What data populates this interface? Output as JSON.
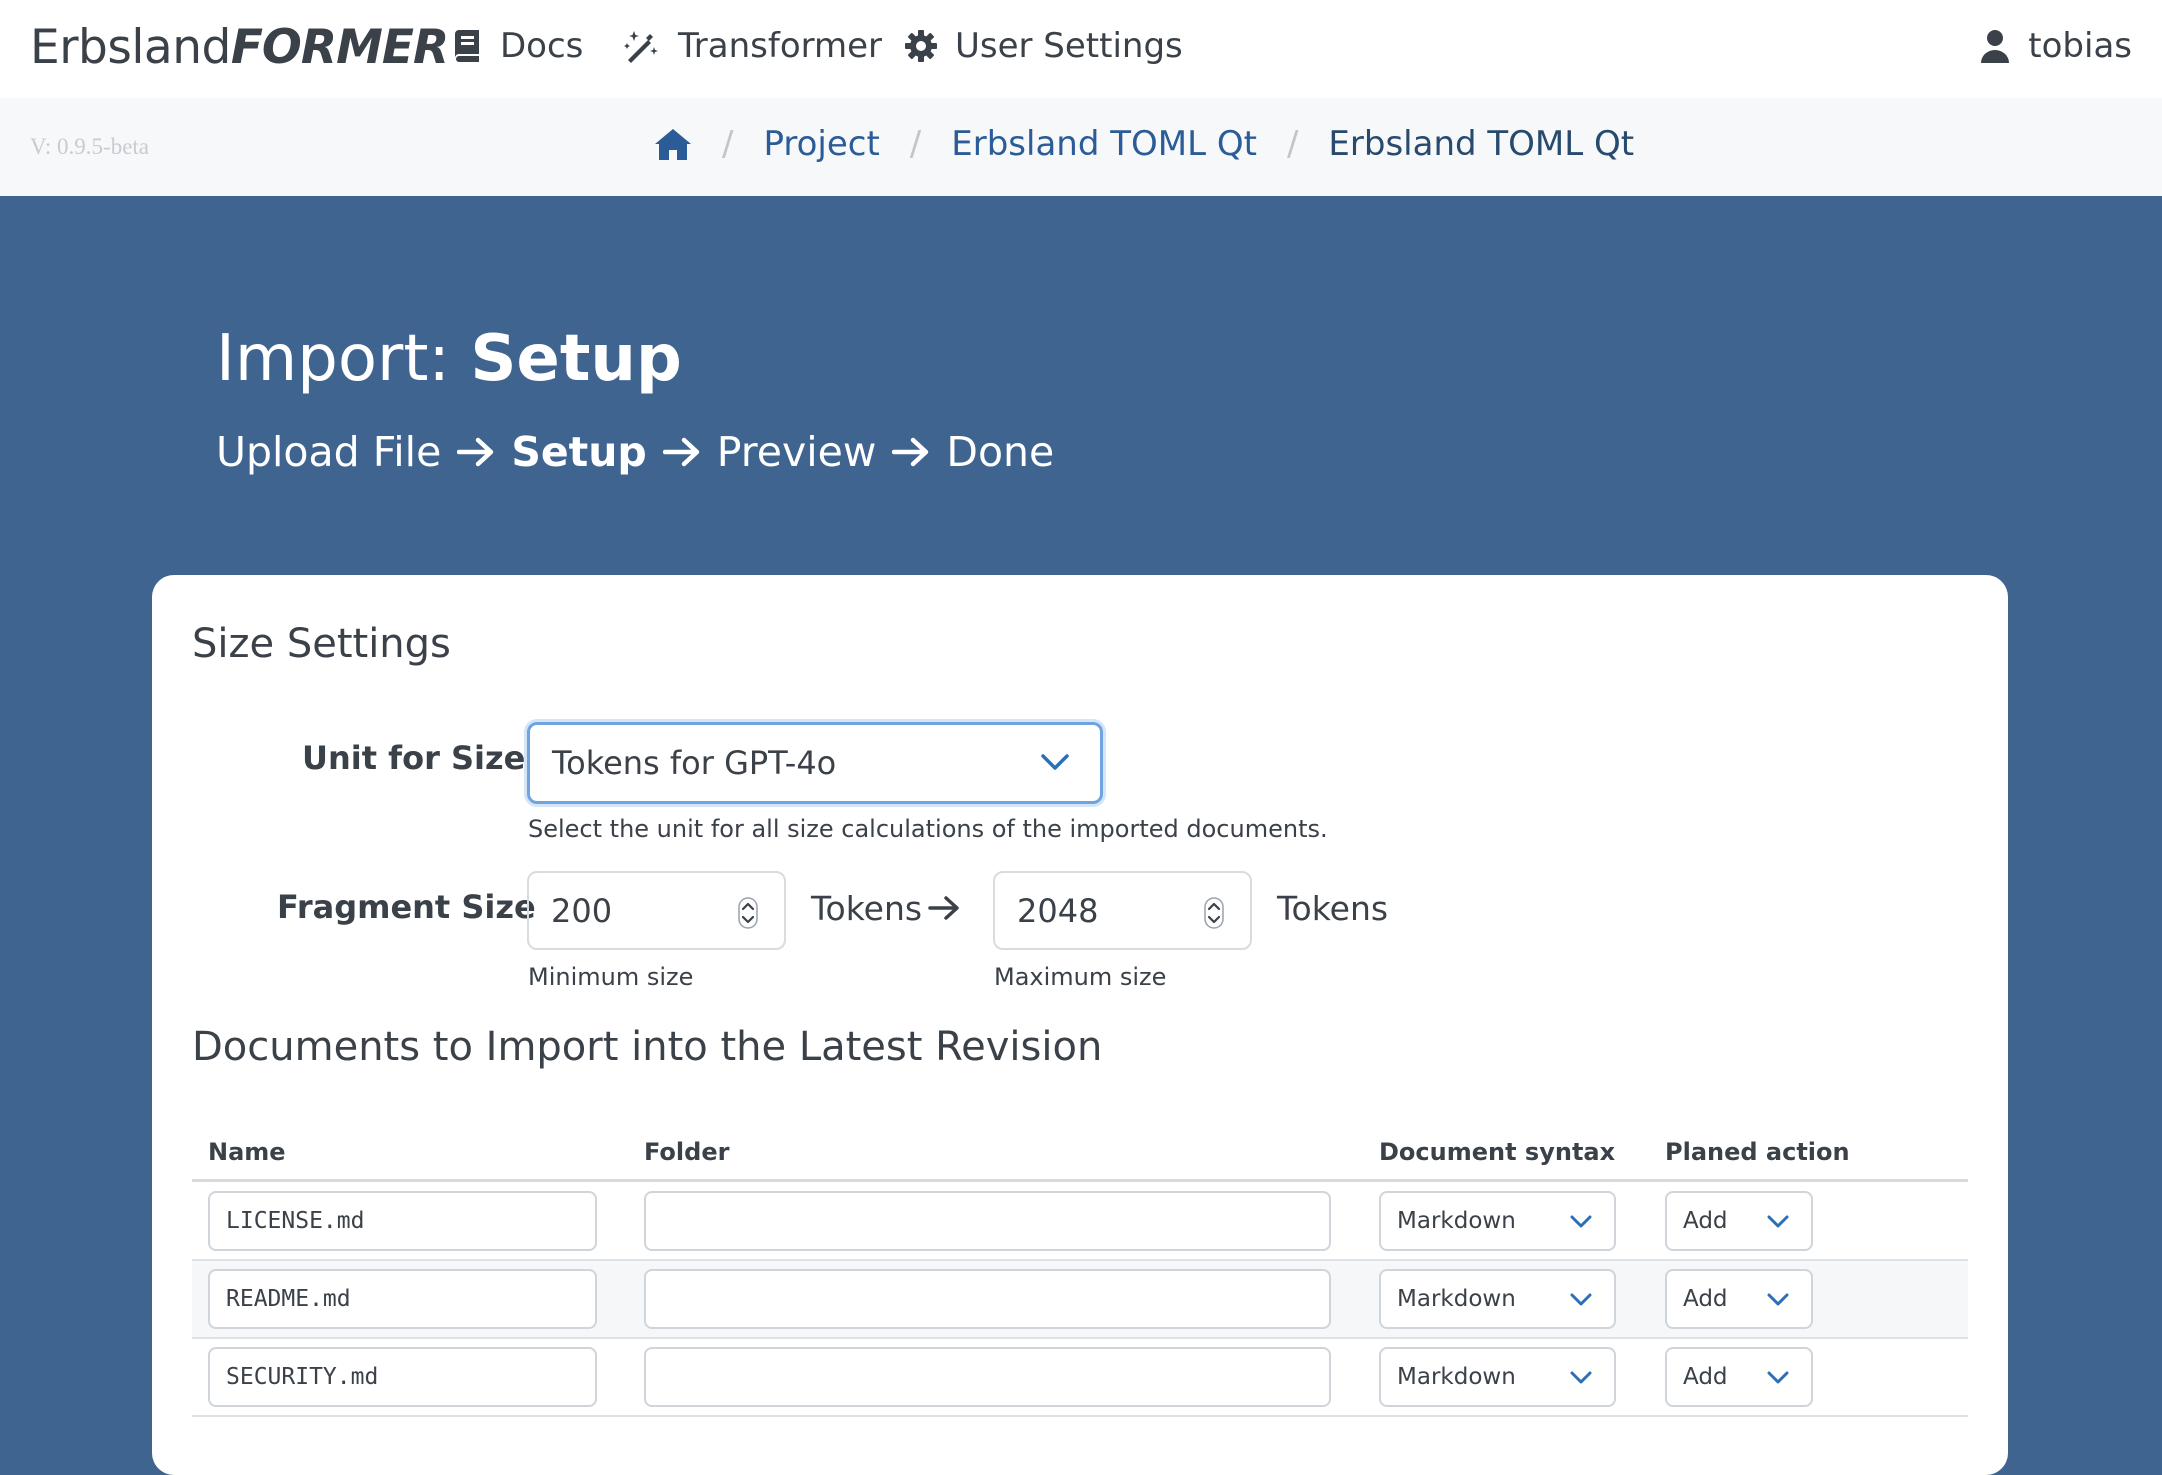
{
  "nav": {
    "brand_a": "Erbsland",
    "brand_b": "FORMER",
    "links": [
      {
        "label": "Docs",
        "icon": "book-icon"
      },
      {
        "label": "Transformer",
        "icon": "magic-wand-icon"
      },
      {
        "label": "User Settings",
        "icon": "gear-icon"
      }
    ],
    "user": "tobias"
  },
  "subbar": {
    "version": "V: 0.9.5-beta",
    "breadcrumb": [
      "Project",
      "Erbsland TOML Qt",
      "Erbsland TOML Qt"
    ]
  },
  "hero": {
    "title_prefix": "Import:",
    "title_bold": "Setup",
    "steps": [
      "Upload File",
      "Setup",
      "Preview",
      "Done"
    ]
  },
  "size_settings": {
    "heading": "Size Settings",
    "unit_label": "Unit for Size",
    "unit_value": "Tokens for GPT-4o",
    "unit_help": "Select the unit for all size calculations of the imported documents.",
    "fragment_label": "Fragment Size",
    "min_value": "200",
    "min_unit": "Tokens",
    "min_help": "Minimum size",
    "max_value": "2048",
    "max_unit": "Tokens",
    "max_help": "Maximum size"
  },
  "documents": {
    "heading": "Documents to Import into the Latest Revision",
    "columns": [
      "Name",
      "Folder",
      "Document syntax",
      "Planed action"
    ],
    "rows": [
      {
        "name": "LICENSE.md",
        "folder": "",
        "syntax": "Markdown",
        "action": "Add"
      },
      {
        "name": "README.md",
        "folder": "",
        "syntax": "Markdown",
        "action": "Add"
      },
      {
        "name": "SECURITY.md",
        "folder": "",
        "syntax": "Markdown",
        "action": "Add"
      }
    ]
  },
  "colors": {
    "hero_bg": "#3f648f",
    "link": "#2b5c97",
    "focus": "#6fa4e0"
  }
}
